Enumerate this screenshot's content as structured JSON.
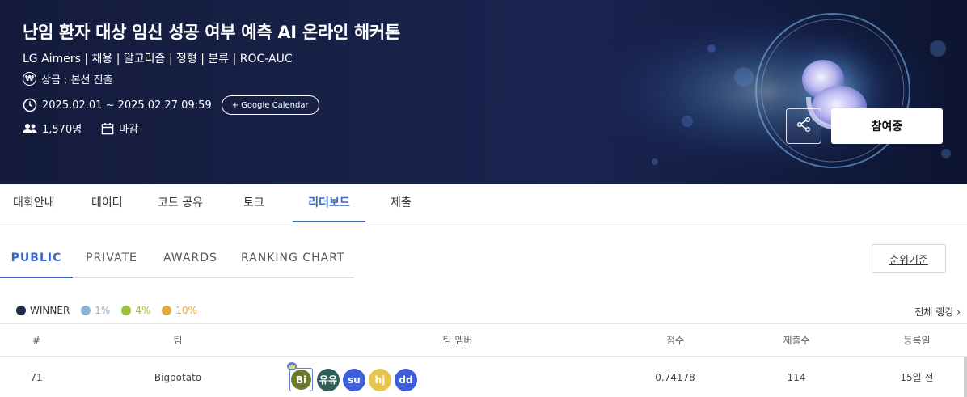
{
  "hero": {
    "title": "난임 환자 대상 임신 성공 여부 예측 AI 온라인 해커톤",
    "subtitle": "LG Aimers | 채용 | 알고리즘 | 정형 | 분류 | ROC-AUC",
    "prize": "상금 : 본선 진출",
    "prize_icon": "won-icon",
    "date_range": "2025.02.01 ~ 2025.02.27 09:59",
    "calendar_button": "+ Google Calendar",
    "participants": "1,570명",
    "status": "마감",
    "join_button": "참여중",
    "share_icon": "share-icon"
  },
  "main_tabs": [
    {
      "label": "대회안내",
      "active": false
    },
    {
      "label": "데이터",
      "active": false
    },
    {
      "label": "코드 공유",
      "active": false
    },
    {
      "label": "토크",
      "active": false
    },
    {
      "label": "리더보드",
      "active": true
    },
    {
      "label": "제출",
      "active": false
    }
  ],
  "sub_tabs": [
    {
      "label": "PUBLIC",
      "active": true
    },
    {
      "label": "PRIVATE",
      "active": false
    },
    {
      "label": "AWARDS",
      "active": false
    },
    {
      "label": "RANKING CHART",
      "active": false
    }
  ],
  "criteria_button": "순위기준",
  "legend": [
    {
      "label": "WINNER",
      "color": "#1f2a44"
    },
    {
      "label": "1%",
      "color": "#8fb3d6"
    },
    {
      "label": "4%",
      "color": "#9dc23b"
    },
    {
      "label": "10%",
      "color": "#e7aa3a"
    }
  ],
  "full_ranking_link": "전체 랭킹",
  "table": {
    "headers": [
      "#",
      "팀",
      "팀 멤버",
      "점수",
      "제출수",
      "등록일"
    ],
    "rows": [
      {
        "rank": "71",
        "team": "Bigpotato",
        "members": [
          {
            "initials": "Bi",
            "color": "#6b7a2e",
            "leader": true
          },
          {
            "initials": "유유",
            "color": "#2f5f5a",
            "leader": false
          },
          {
            "initials": "su",
            "color": "#3d5fd9",
            "leader": false
          },
          {
            "initials": "hj",
            "color": "#e9c44c",
            "leader": false
          },
          {
            "initials": "dd",
            "color": "#3d5fd9",
            "leader": false
          }
        ],
        "score": "0.74178",
        "submissions": "114",
        "registered": "15일 전"
      }
    ]
  },
  "colors": {
    "accent": "#3a64c8",
    "hero_bg": "#19224a"
  }
}
